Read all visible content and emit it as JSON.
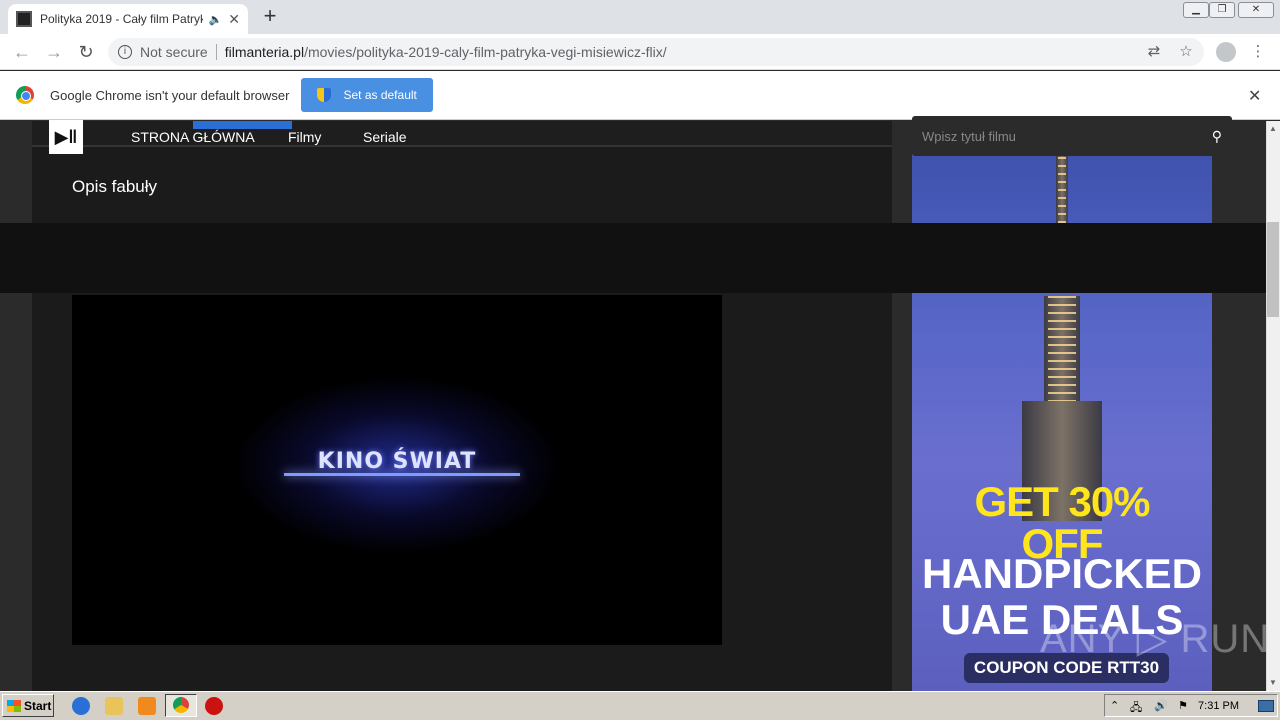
{
  "browser": {
    "tab_title": "Polityka 2019 - Cały film Patryk",
    "new_tab_label": "+",
    "security_label": "Not secure",
    "url_domain": "filmanteria.pl",
    "url_path": "/movies/polityka-2019-caly-film-patryka-vegi-misiewicz-flix/"
  },
  "infobar": {
    "message": "Google Chrome isn't your default browser",
    "button_label": "Set as default",
    "close_glyph": "✕"
  },
  "site": {
    "section_heading": "Opis fabuły",
    "logo_glyph": "▶‖",
    "nav": [
      "STRONA GŁÓWNA",
      "Filmy",
      "Seriale"
    ],
    "search_placeholder": "Wpisz tytuł filmu"
  },
  "video": {
    "overlay_text": "KINO ŚWIAT"
  },
  "ad": {
    "line1": "GET 30% OFF",
    "line2a": "HANDPICKED",
    "line2b": "UAE DEALS",
    "coupon": "COUPON CODE RTT30"
  },
  "watermark": "ANY ▷ RUN",
  "taskbar": {
    "start_label": "Start",
    "clock": "7:31 PM"
  },
  "colors": {
    "accent_blue": "#4a90e2",
    "site_bg": "#1b1b1b",
    "ad_yellow": "#ffe51a"
  }
}
